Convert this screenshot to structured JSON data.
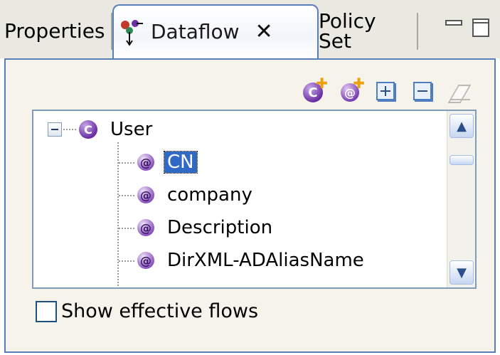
{
  "tabs": [
    {
      "label": "Properties",
      "active": false
    },
    {
      "label": "Dataflow",
      "active": true,
      "icon": "dataflow-icon",
      "close": "✕"
    },
    {
      "label": "Policy Set",
      "active": false
    }
  ],
  "toolbar": {
    "buttons": [
      {
        "name": "add-class-button",
        "glyph": "C"
      },
      {
        "name": "add-attribute-button",
        "glyph": "@"
      },
      {
        "name": "expand-all-button"
      },
      {
        "name": "collapse-all-button"
      },
      {
        "name": "clear-button",
        "enabled": false
      }
    ]
  },
  "tree": {
    "root": {
      "label": "User",
      "icon": "class-icon",
      "glyph": "C",
      "expanded": true
    },
    "children": [
      {
        "label": "CN",
        "selected": true,
        "glyph": "@"
      },
      {
        "label": "company",
        "selected": false,
        "glyph": "@"
      },
      {
        "label": "Description",
        "selected": false,
        "glyph": "@"
      },
      {
        "label": "DirXML-ADAliasName",
        "selected": false,
        "glyph": "@"
      }
    ]
  },
  "scrollbar": {
    "up": "▲",
    "down": "▼"
  },
  "checkbox": {
    "label": "Show effective flows",
    "checked": false
  },
  "colors": {
    "accent": "#5a7fb8",
    "selection": "#316ac5",
    "class_icon": "#6a2fa3"
  }
}
